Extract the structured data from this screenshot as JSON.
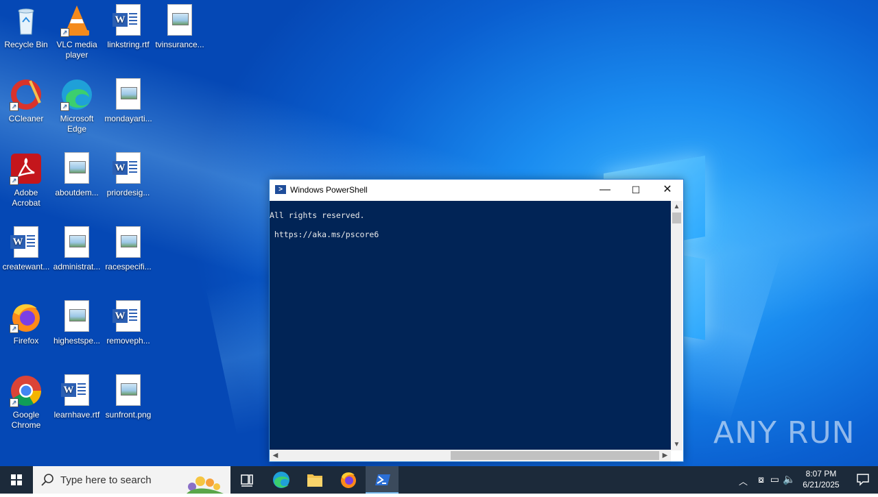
{
  "desktop": {
    "icons": [
      {
        "label": "Recycle Bin",
        "kind": "recycle-bin"
      },
      {
        "label": "VLC media player",
        "kind": "vlc"
      },
      {
        "label": "linkstring.rtf",
        "kind": "word"
      },
      {
        "label": "tvinsurance...",
        "kind": "image"
      },
      {
        "label": "CCleaner",
        "kind": "ccleaner"
      },
      {
        "label": "Microsoft Edge",
        "kind": "edge"
      },
      {
        "label": "mondayarti...",
        "kind": "image"
      },
      {
        "label": "Adobe Acrobat",
        "kind": "acrobat"
      },
      {
        "label": "aboutdem...",
        "kind": "image"
      },
      {
        "label": "priordesig...",
        "kind": "word"
      },
      {
        "label": "createwant...",
        "kind": "word"
      },
      {
        "label": "administrat...",
        "kind": "image"
      },
      {
        "label": "racespecifi...",
        "kind": "image"
      },
      {
        "label": "Firefox",
        "kind": "firefox"
      },
      {
        "label": "highestspe...",
        "kind": "image"
      },
      {
        "label": "removeph...",
        "kind": "word"
      },
      {
        "label": "Google Chrome",
        "kind": "chrome"
      },
      {
        "label": "learnhave.rtf",
        "kind": "word"
      },
      {
        "label": "sunfront.png",
        "kind": "image"
      }
    ]
  },
  "window": {
    "title": "Windows PowerShell",
    "console_lines": [
      "All rights reserved.",
      " https://aka.ms/pscore6"
    ],
    "minimize": "—",
    "maximize": "☐",
    "close": "✕"
  },
  "taskbar": {
    "search_placeholder": "Type here to search",
    "time": "8:07 PM",
    "date": "6/21/2025"
  },
  "watermark": "ANY RUN"
}
